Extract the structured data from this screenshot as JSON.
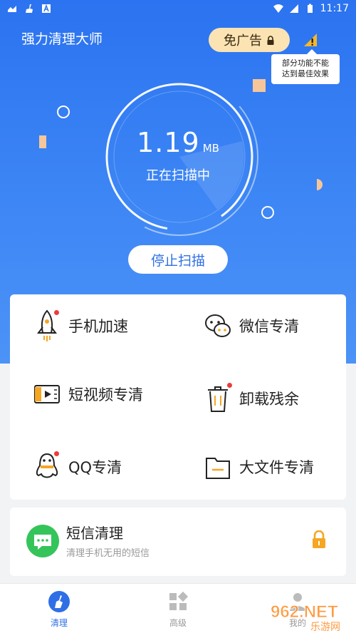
{
  "status_bar": {
    "time": "11:17"
  },
  "app": {
    "title": "强力清理大师"
  },
  "no_ads_button": {
    "label": "免广告"
  },
  "tooltip": {
    "line1": "部分功能不能",
    "line2": "达到最佳效果"
  },
  "scan": {
    "size_value": "1.19",
    "size_unit": "MB",
    "status": "正在扫描中",
    "stop_label": "停止扫描"
  },
  "features": [
    {
      "label": "手机加速",
      "icon": "rocket-icon",
      "badge": true
    },
    {
      "label": "微信专清",
      "icon": "wechat-icon",
      "badge": false
    },
    {
      "label": "短视频专清",
      "icon": "video-icon",
      "badge": false
    },
    {
      "label": "卸载残余",
      "icon": "trash-icon",
      "badge": true
    },
    {
      "label": "QQ专清",
      "icon": "qq-penguin-icon",
      "badge": true
    },
    {
      "label": "大文件专清",
      "icon": "folder-icon",
      "badge": false
    }
  ],
  "sms_card": {
    "title": "短信清理",
    "subtitle": "清理手机无用的短信"
  },
  "tabs": [
    {
      "label": "清理",
      "icon": "broom-icon",
      "active": true
    },
    {
      "label": "高级",
      "icon": "grid-icon",
      "active": false
    },
    {
      "label": "我的",
      "icon": "user-icon",
      "active": false
    }
  ],
  "watermark": {
    "text": "962.NET",
    "subtext": "乐游网"
  },
  "colors": {
    "primary": "#2f6fe6",
    "hero_top": "#2b73f0",
    "badge": "#ee3b3b",
    "accent_orange": "#f5a623",
    "sms_green": "#35c45a"
  }
}
